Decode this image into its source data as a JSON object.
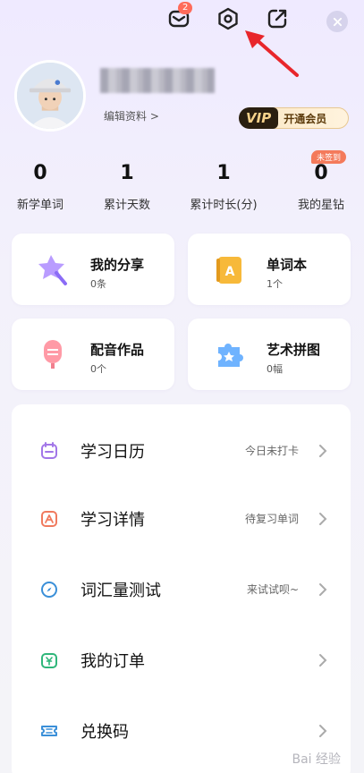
{
  "header": {
    "mail_badge": "2"
  },
  "profile": {
    "edit_label": "编辑资料 >",
    "vip_logo": "VIP",
    "vip_cta": "开通会员"
  },
  "stats": [
    {
      "value": "0",
      "label": "新学单词"
    },
    {
      "value": "1",
      "label": "累计天数"
    },
    {
      "value": "1",
      "label": "累计时长(分)"
    },
    {
      "value": "0",
      "label": "我的星钻",
      "badge": "未签到"
    }
  ],
  "cards": [
    {
      "title": "我的分享",
      "sub": "0条"
    },
    {
      "title": "单词本",
      "sub": "1个"
    },
    {
      "title": "配音作品",
      "sub": "0个"
    },
    {
      "title": "艺术拼图",
      "sub": "0幅"
    }
  ],
  "menu": [
    {
      "label": "学习日历",
      "value": "今日未打卡"
    },
    {
      "label": "学习详情",
      "value": "待复习单词"
    },
    {
      "label": "词汇量测试",
      "value": "来试试呗~"
    },
    {
      "label": "我的订单",
      "value": ""
    },
    {
      "label": "兑换码",
      "value": ""
    }
  ],
  "watermark": "Bai 经验",
  "colors": {
    "accent_purple": "#8b6cf6",
    "vip_gold": "#f6d28b",
    "badge_red": "#ff6b5a",
    "arrow_red": "#e8262b"
  }
}
